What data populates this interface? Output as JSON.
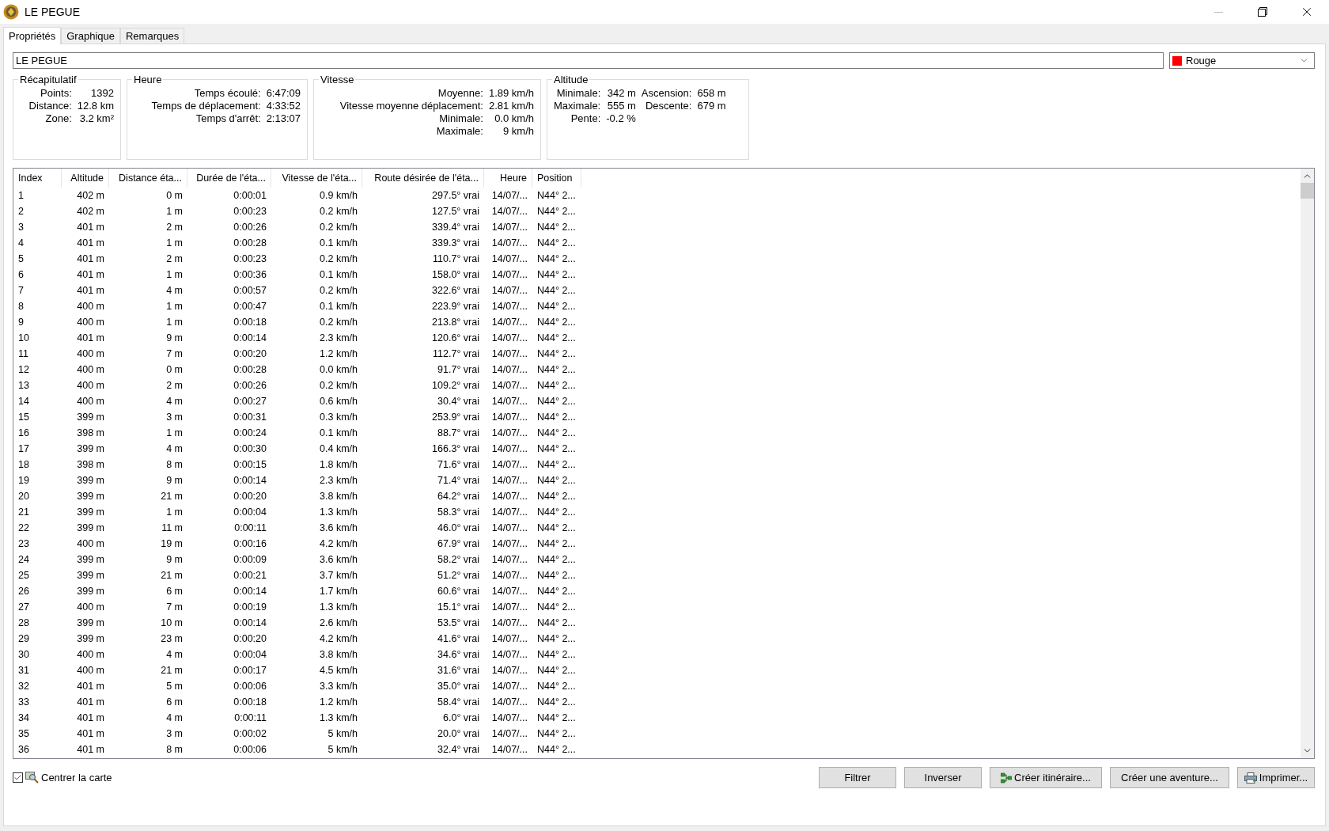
{
  "window": {
    "title": "LE PEGUE"
  },
  "tabs": [
    {
      "label": "Propriétés",
      "selected": true
    },
    {
      "label": "Graphique",
      "selected": false
    },
    {
      "label": "Remarques",
      "selected": false
    }
  ],
  "name_field": {
    "value": "LE PEGUE"
  },
  "color_select": {
    "value": "Rouge",
    "color": "#ff0000"
  },
  "stat_groups": [
    {
      "title": "Récapitulatif",
      "rows": [
        [
          "Points:",
          "1392"
        ],
        [
          "Distance:",
          "12.8 km"
        ],
        [
          "Zone:",
          "3.2 km²"
        ]
      ]
    },
    {
      "title": "Heure",
      "rows": [
        [
          "Temps écoulé:",
          "6:47:09"
        ],
        [
          "Temps de déplacement:",
          "4:33:52"
        ],
        [
          "Temps d'arrêt:",
          "2:13:07"
        ]
      ]
    },
    {
      "title": "Vitesse",
      "rows": [
        [
          "Moyenne:",
          "1.89 km/h"
        ],
        [
          "Vitesse moyenne déplacement:",
          "2.81 km/h"
        ],
        [
          "Minimale:",
          "0.0 km/h"
        ],
        [
          "Maximale:",
          "9 km/h"
        ]
      ]
    },
    {
      "title": "Altitude",
      "rows": [
        [
          "Minimale:",
          "342 m",
          "Ascension:",
          "658 m"
        ],
        [
          "Maximale:",
          "555 m",
          "Descente:",
          "679 m"
        ],
        [
          "Pente:",
          "-0.2 %"
        ]
      ]
    }
  ],
  "table": {
    "columns": [
      "Index",
      "Altitude",
      "Distance éta...",
      "Durée de l'éta...",
      "Vitesse de l'éta...",
      "Route désirée de l'éta...",
      "Heure",
      "Position"
    ],
    "rows": [
      [
        "1",
        "402 m",
        "0 m",
        "0:00:01",
        "0.9 km/h",
        "297.5° vrai",
        "14/07/...",
        "N44° 2..."
      ],
      [
        "2",
        "402 m",
        "1 m",
        "0:00:23",
        "0.2 km/h",
        "127.5° vrai",
        "14/07/...",
        "N44° 2..."
      ],
      [
        "3",
        "401 m",
        "2 m",
        "0:00:26",
        "0.2 km/h",
        "339.4° vrai",
        "14/07/...",
        "N44° 2..."
      ],
      [
        "4",
        "401 m",
        "1 m",
        "0:00:28",
        "0.1 km/h",
        "339.3° vrai",
        "14/07/...",
        "N44° 2..."
      ],
      [
        "5",
        "401 m",
        "2 m",
        "0:00:23",
        "0.2 km/h",
        "110.7° vrai",
        "14/07/...",
        "N44° 2..."
      ],
      [
        "6",
        "401 m",
        "1 m",
        "0:00:36",
        "0.1 km/h",
        "158.0° vrai",
        "14/07/...",
        "N44° 2..."
      ],
      [
        "7",
        "401 m",
        "4 m",
        "0:00:57",
        "0.2 km/h",
        "322.6° vrai",
        "14/07/...",
        "N44° 2..."
      ],
      [
        "8",
        "400 m",
        "1 m",
        "0:00:47",
        "0.1 km/h",
        "223.9° vrai",
        "14/07/...",
        "N44° 2..."
      ],
      [
        "9",
        "400 m",
        "1 m",
        "0:00:18",
        "0.2 km/h",
        "213.8° vrai",
        "14/07/...",
        "N44° 2..."
      ],
      [
        "10",
        "401 m",
        "9 m",
        "0:00:14",
        "2.3 km/h",
        "120.6° vrai",
        "14/07/...",
        "N44° 2..."
      ],
      [
        "11",
        "400 m",
        "7 m",
        "0:00:20",
        "1.2 km/h",
        "112.7° vrai",
        "14/07/...",
        "N44° 2..."
      ],
      [
        "12",
        "400 m",
        "0 m",
        "0:00:28",
        "0.0 km/h",
        "91.7° vrai",
        "14/07/...",
        "N44° 2..."
      ],
      [
        "13",
        "400 m",
        "2 m",
        "0:00:26",
        "0.2 km/h",
        "109.2° vrai",
        "14/07/...",
        "N44° 2..."
      ],
      [
        "14",
        "400 m",
        "4 m",
        "0:00:27",
        "0.6 km/h",
        "30.4° vrai",
        "14/07/...",
        "N44° 2..."
      ],
      [
        "15",
        "399 m",
        "3 m",
        "0:00:31",
        "0.3 km/h",
        "253.9° vrai",
        "14/07/...",
        "N44° 2..."
      ],
      [
        "16",
        "398 m",
        "1 m",
        "0:00:24",
        "0.1 km/h",
        "88.7° vrai",
        "14/07/...",
        "N44° 2..."
      ],
      [
        "17",
        "399 m",
        "4 m",
        "0:00:30",
        "0.4 km/h",
        "166.3° vrai",
        "14/07/...",
        "N44° 2..."
      ],
      [
        "18",
        "398 m",
        "8 m",
        "0:00:15",
        "1.8 km/h",
        "71.6° vrai",
        "14/07/...",
        "N44° 2..."
      ],
      [
        "19",
        "399 m",
        "9 m",
        "0:00:14",
        "2.3 km/h",
        "71.4° vrai",
        "14/07/...",
        "N44° 2..."
      ],
      [
        "20",
        "399 m",
        "21 m",
        "0:00:20",
        "3.8 km/h",
        "64.2° vrai",
        "14/07/...",
        "N44° 2..."
      ],
      [
        "21",
        "399 m",
        "1 m",
        "0:00:04",
        "1.3 km/h",
        "58.3° vrai",
        "14/07/...",
        "N44° 2..."
      ],
      [
        "22",
        "399 m",
        "11 m",
        "0:00:11",
        "3.6 km/h",
        "46.0° vrai",
        "14/07/...",
        "N44° 2..."
      ],
      [
        "23",
        "400 m",
        "19 m",
        "0:00:16",
        "4.2 km/h",
        "67.9° vrai",
        "14/07/...",
        "N44° 2..."
      ],
      [
        "24",
        "399 m",
        "9 m",
        "0:00:09",
        "3.6 km/h",
        "58.2° vrai",
        "14/07/...",
        "N44° 2..."
      ],
      [
        "25",
        "399 m",
        "21 m",
        "0:00:21",
        "3.7 km/h",
        "51.2° vrai",
        "14/07/...",
        "N44° 2..."
      ],
      [
        "26",
        "399 m",
        "6 m",
        "0:00:14",
        "1.7 km/h",
        "60.6° vrai",
        "14/07/...",
        "N44° 2..."
      ],
      [
        "27",
        "400 m",
        "7 m",
        "0:00:19",
        "1.3 km/h",
        "15.1° vrai",
        "14/07/...",
        "N44° 2..."
      ],
      [
        "28",
        "399 m",
        "10 m",
        "0:00:14",
        "2.6 km/h",
        "53.5° vrai",
        "14/07/...",
        "N44° 2..."
      ],
      [
        "29",
        "399 m",
        "23 m",
        "0:00:20",
        "4.2 km/h",
        "41.6° vrai",
        "14/07/...",
        "N44° 2..."
      ],
      [
        "30",
        "400 m",
        "4 m",
        "0:00:04",
        "3.8 km/h",
        "34.6° vrai",
        "14/07/...",
        "N44° 2..."
      ],
      [
        "31",
        "400 m",
        "21 m",
        "0:00:17",
        "4.5 km/h",
        "31.6° vrai",
        "14/07/...",
        "N44° 2..."
      ],
      [
        "32",
        "401 m",
        "5 m",
        "0:00:06",
        "3.3 km/h",
        "35.0° vrai",
        "14/07/...",
        "N44° 2..."
      ],
      [
        "33",
        "401 m",
        "6 m",
        "0:00:18",
        "1.2 km/h",
        "58.4° vrai",
        "14/07/...",
        "N44° 2..."
      ],
      [
        "34",
        "401 m",
        "4 m",
        "0:00:11",
        "1.3 km/h",
        "6.0° vrai",
        "14/07/...",
        "N44° 2..."
      ],
      [
        "35",
        "401 m",
        "3 m",
        "0:00:02",
        "5 km/h",
        "20.0° vrai",
        "14/07/...",
        "N44° 2..."
      ],
      [
        "36",
        "401 m",
        "8 m",
        "0:00:06",
        "5 km/h",
        "32.4° vrai",
        "14/07/...",
        "N44° 2..."
      ]
    ]
  },
  "center_map": {
    "label": "Centrer la carte",
    "checked": true
  },
  "buttons": [
    {
      "label": "Filtrer",
      "kind": "plain"
    },
    {
      "label": "Inverser",
      "kind": "plain"
    },
    {
      "label": "Créer itinéraire...",
      "kind": "route"
    },
    {
      "label": "Créer une aventure...",
      "kind": "plain"
    },
    {
      "label": "Imprimer...",
      "kind": "print"
    }
  ]
}
